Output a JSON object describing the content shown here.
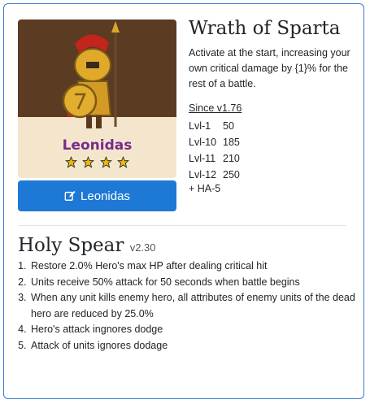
{
  "hero": {
    "name": "Leonidas",
    "stars": 4,
    "button_label": "Leonidas",
    "button_icon": "edit-icon"
  },
  "skill": {
    "title": "Wrath of Sparta",
    "description": "Activate at the start, increasing your own critical damage by {1}% for the rest of a battle.",
    "since": "Since v1.76",
    "levels": [
      {
        "level": "Lvl-1",
        "value": "50"
      },
      {
        "level": "Lvl-10",
        "value": "185"
      },
      {
        "level": "Lvl-11",
        "value": "210"
      },
      {
        "level": "Lvl-12",
        "value": "250"
      }
    ],
    "extra": "+ HA-5"
  },
  "weapon": {
    "title": "Holy Spear",
    "version": "v2.30",
    "perks": [
      "Restore 2.0% Hero's max HP after dealing critical hit",
      "Units receive 50% attack for 50 seconds when battle begins",
      "When any unit kills enemy hero, all attributes of enemy units of the dead hero are reduced by 25.0%",
      "Hero's attack ingnores dodge",
      "Attack of units ignores dodage"
    ]
  },
  "colors": {
    "button": "#1e78d6",
    "border": "#3a7bd5",
    "hero_name": "#7b2a8d",
    "star": "#f2b705"
  }
}
